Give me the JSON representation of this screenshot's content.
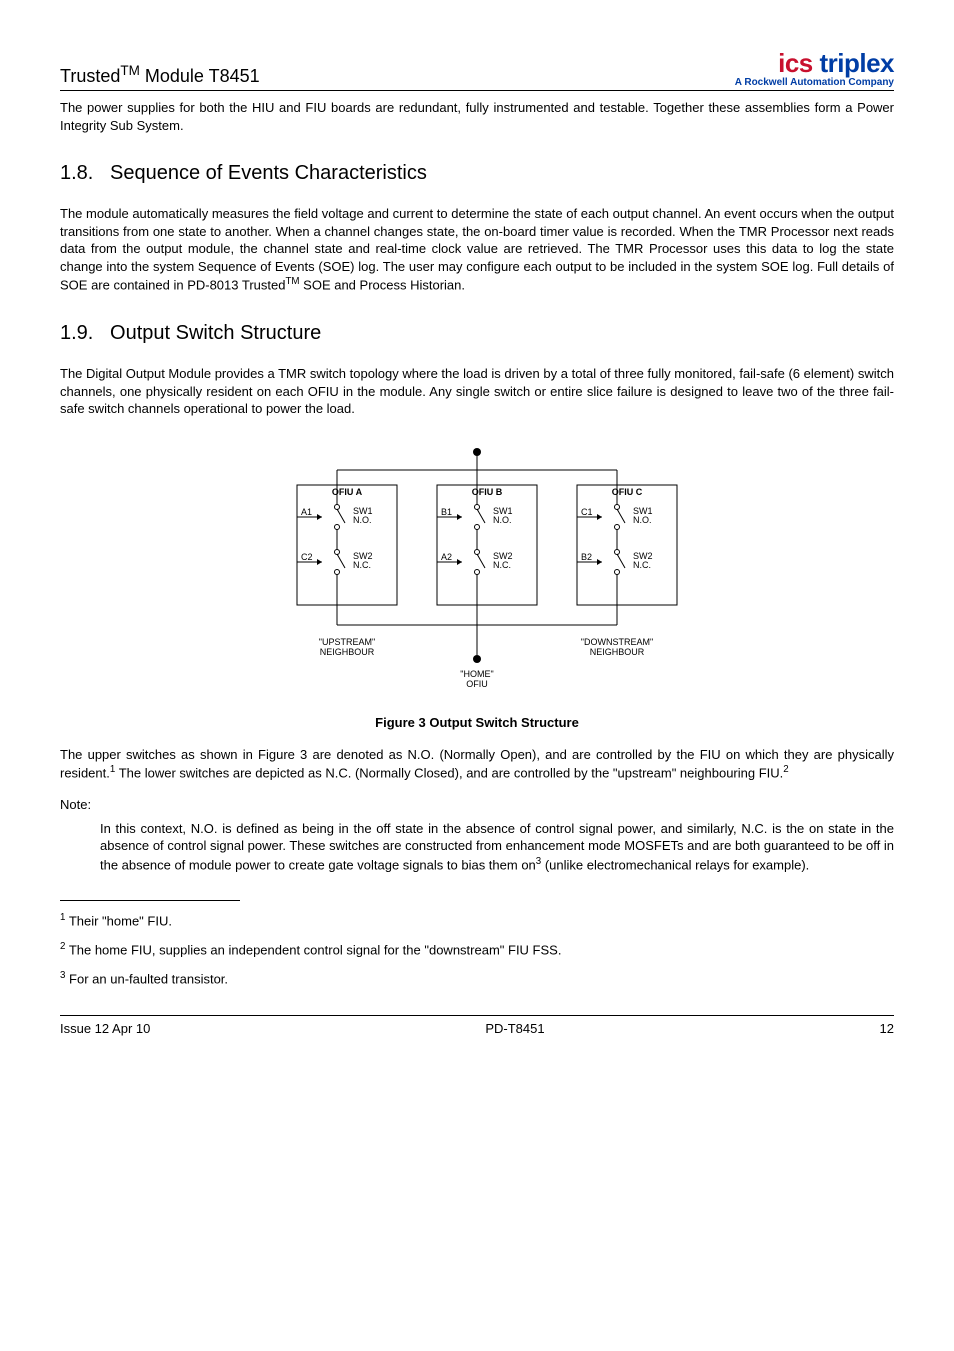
{
  "header": {
    "product_line": "Trusted",
    "tm": "TM",
    "module": " Module T8451",
    "logo_ics": "ics",
    "logo_triplex": " triplex",
    "logo_sub_prefix": "A ",
    "logo_sub_bold": "Rockwell Automation",
    "logo_sub_suffix": " Company"
  },
  "intro_para": "The power supplies for both the HIU and FIU boards are redundant, fully instrumented and testable. Together these assemblies form a Power Integrity Sub System.",
  "sec18": {
    "num": "1.8.",
    "title": "Sequence of Events Characteristics",
    "para_a": "The module automatically measures the field voltage and current to determine the state of each output channel.  An event occurs when the output transitions from one state to another.  When a channel changes state, the on-board timer value is recorded.  When the TMR Processor next reads data from the output module, the channel state and real-time clock value are retrieved.  The TMR Processor uses this data to log the state change into the system Sequence of Events (SOE) log.  The user may configure each output to be included in the system SOE log.  Full details of SOE are contained in PD-8013 Trusted",
    "para_b": " SOE and Process Historian."
  },
  "sec19": {
    "num": "1.9.",
    "title": "Output Switch Structure",
    "para1": "The Digital Output Module provides a TMR switch topology where the load is driven by a total of three fully monitored, fail-safe (6 element) switch channels, one physically resident on each OFIU in the module.  Any single switch or entire slice failure is designed to leave two of the three fail-safe switch channels operational to power the load.",
    "caption": "Figure 3 Output Switch Structure",
    "para2_a": "The upper switches as shown in Figure 3 are denoted as N.O. (Normally Open), and are controlled by the FIU on which they are physically resident.",
    "para2_b": "  The lower switches are depicted as N.C. (Normally Closed), and are controlled by the \"upstream\" neighbouring FIU.",
    "note_label": "Note:",
    "note_a": "In this context, N.O. is defined as being in the off state in the absence of control signal power, and similarly, N.C. is the on state in the absence of control signal power.  These switches are constructed from enhancement mode MOSFETs and are both guaranteed to be off in the absence of module power to create gate voltage signals to bias them on",
    "note_b": " (unlike electromechanical relays for example)."
  },
  "footnotes": {
    "f1": " Their \"home\" FIU.",
    "f2": " The home FIU, supplies an independent control signal for the \"downstream\" FIU FSS.",
    "f3": " For an un-faulted transistor."
  },
  "footer": {
    "left": "Issue 12 Apr 10",
    "center": "PD-T8451",
    "right": "12"
  },
  "diagram": {
    "ofiu_a": "OFIU A",
    "ofiu_b": "OFIU B",
    "ofiu_c": "OFIU C",
    "a1": "A1",
    "a2": "A2",
    "b1": "B1",
    "b2": "B2",
    "c1": "C1",
    "c2": "C2",
    "sw1": "SW1",
    "sw2": "SW2",
    "no": "N.O.",
    "nc": "N.C.",
    "upstream1": "\"UPSTREAM\"",
    "upstream2": "NEIGHBOUR",
    "home1": "\"HOME\"",
    "home2": "OFIU",
    "downstream1": "\"DOWNSTREAM\"",
    "downstream2": "NEIGHBOUR"
  }
}
